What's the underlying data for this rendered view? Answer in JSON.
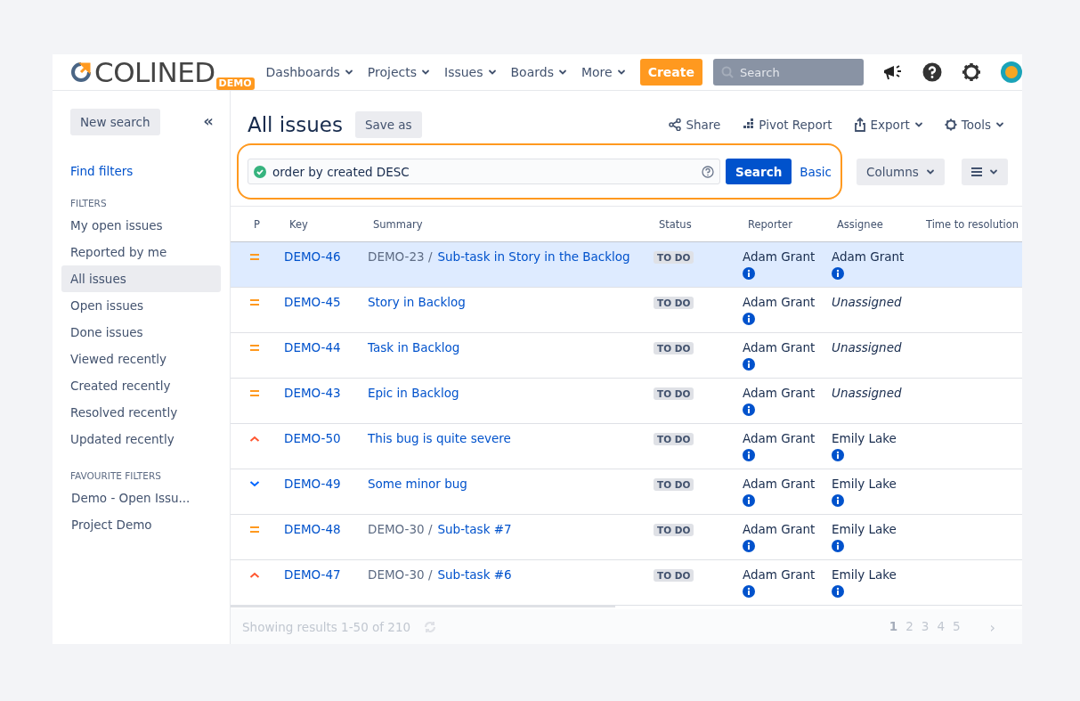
{
  "header": {
    "logo": "COLINED",
    "logo_badge": "DEMO",
    "nav": [
      "Dashboards",
      "Projects",
      "Issues",
      "Boards",
      "More"
    ],
    "create": "Create",
    "search": {
      "placeholder": "Search"
    }
  },
  "sidebar": {
    "new_search": "New search",
    "collapse": "«",
    "find_filters": "Find filters",
    "filters_heading": "FILTERS",
    "filters": [
      {
        "label": "My open issues",
        "selected": false
      },
      {
        "label": "Reported by me",
        "selected": false
      },
      {
        "label": "All issues",
        "selected": true
      },
      {
        "label": "Open issues",
        "selected": false
      },
      {
        "label": "Done issues",
        "selected": false
      },
      {
        "label": "Viewed recently",
        "selected": false
      },
      {
        "label": "Created recently",
        "selected": false
      },
      {
        "label": "Resolved recently",
        "selected": false
      },
      {
        "label": "Updated recently",
        "selected": false
      }
    ],
    "favourites_heading": "FAVOURITE FILTERS",
    "favourites": [
      "Demo - Open Issu...",
      "Project Demo"
    ]
  },
  "main": {
    "title": "All issues",
    "save_as": "Save as",
    "actions": [
      "Share",
      "Pivot Report",
      "Export",
      "Tools"
    ],
    "query": {
      "value": "order by created DESC",
      "valid": true
    },
    "search_button": "Search",
    "basic": "Basic",
    "columns_button": "Columns"
  },
  "table": {
    "columns": [
      "P",
      "Key",
      "Summary",
      "Status",
      "Reporter",
      "Assignee",
      "Time to resolution"
    ],
    "rows": [
      {
        "kind": "medium",
        "key": "DEMO-46",
        "parent": "DEMO-23 /",
        "summary": "Sub-task in Story in the Backlog",
        "status": "TO DO",
        "reporter": "Adam Grant",
        "assignee": "Adam Grant",
        "unassigned": false,
        "selected": true
      },
      {
        "kind": "medium",
        "key": "DEMO-45",
        "summary": "Story in Backlog",
        "status": "TO DO",
        "reporter": "Adam Grant",
        "assignee": "Unassigned",
        "unassigned": true,
        "selected": false
      },
      {
        "kind": "medium",
        "key": "DEMO-44",
        "summary": "Task in Backlog",
        "status": "TO DO",
        "reporter": "Adam Grant",
        "assignee": "Unassigned",
        "unassigned": true,
        "selected": false
      },
      {
        "kind": "medium",
        "key": "DEMO-43",
        "summary": "Epic in Backlog",
        "status": "TO DO",
        "reporter": "Adam Grant",
        "assignee": "Unassigned",
        "unassigned": true,
        "selected": false
      },
      {
        "kind": "high",
        "key": "DEMO-50",
        "summary": "This bug is quite severe",
        "status": "TO DO",
        "reporter": "Adam Grant",
        "assignee": "Emily Lake",
        "unassigned": false,
        "selected": false
      },
      {
        "kind": "low",
        "key": "DEMO-49",
        "summary": "Some minor bug",
        "status": "TO DO",
        "reporter": "Adam Grant",
        "assignee": "Emily Lake",
        "unassigned": false,
        "selected": false
      },
      {
        "kind": "medium",
        "key": "DEMO-48",
        "parent": "DEMO-30 /",
        "summary": "Sub-task #7",
        "status": "TO DO",
        "reporter": "Adam Grant",
        "assignee": "Emily Lake",
        "unassigned": false,
        "selected": false
      },
      {
        "kind": "high",
        "key": "DEMO-47",
        "parent": "DEMO-30 /",
        "summary": "Sub-task #6",
        "status": "TO DO",
        "reporter": "Adam Grant",
        "assignee": "Emily Lake",
        "unassigned": false,
        "selected": false
      }
    ]
  },
  "footer": {
    "results": "Showing results 1-50 of 210",
    "pages": [
      {
        "label": "1",
        "selected": true
      },
      {
        "label": "2",
        "selected": false
      },
      {
        "label": "3",
        "selected": false
      },
      {
        "label": "4",
        "selected": false
      },
      {
        "label": "5",
        "selected": false
      }
    ],
    "next": "›"
  }
}
